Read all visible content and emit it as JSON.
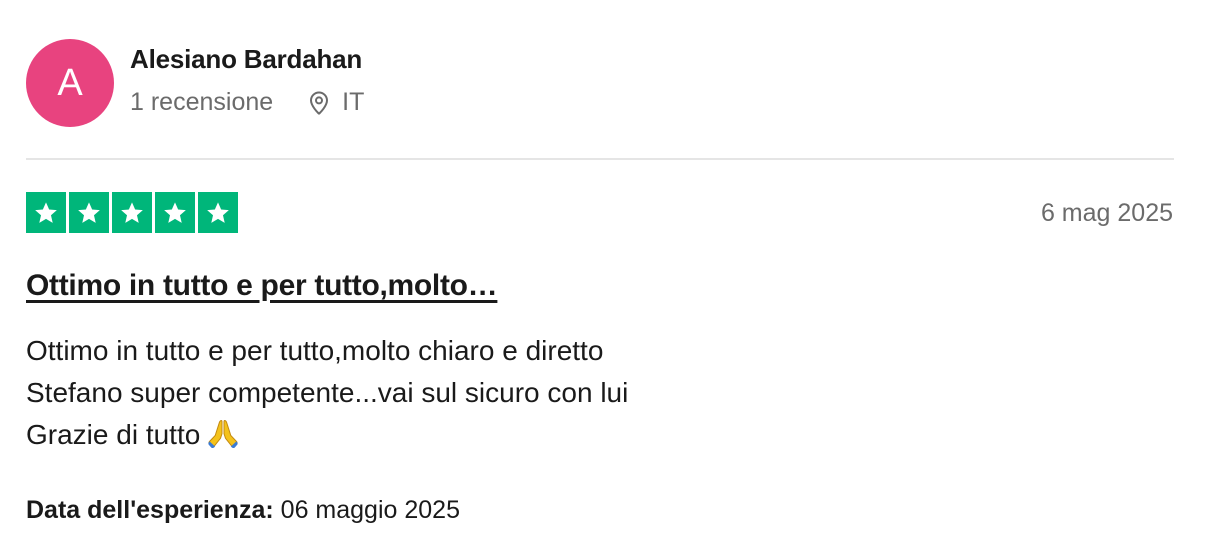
{
  "consumer": {
    "avatar_initial": "A",
    "name": "Alesiano Bardahan",
    "review_count": "1 recensione",
    "country": "IT",
    "avatar_color": "#e8437f"
  },
  "review": {
    "rating": 5,
    "rating_max": 5,
    "star_color": "#00b67a",
    "date": "6 mag 2025",
    "title": "Ottimo in tutto e per tutto,molto…",
    "body_lines": [
      "Ottimo in tutto e per tutto,molto chiaro e diretto",
      "Stefano super competente...vai sul sicuro con lui",
      "Grazie di tutto"
    ],
    "body_emoji": "folded-hands-icon",
    "experience_label": "Data dell'esperienza:",
    "experience_date": "06 maggio 2025"
  },
  "icons": {
    "location": "location-pin-icon",
    "star": "star-icon"
  }
}
